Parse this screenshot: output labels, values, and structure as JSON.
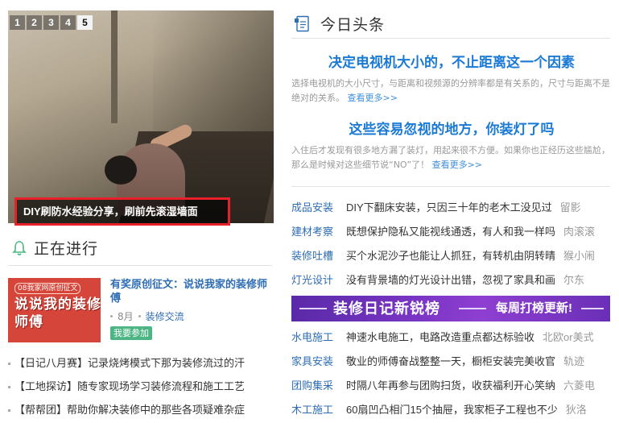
{
  "slider": {
    "numbers": [
      "1",
      "2",
      "3",
      "4",
      "5"
    ],
    "active_index": 4,
    "caption": "DIY刷防水经验分享，刷前先滚湿墙面"
  },
  "in_progress": {
    "title": "正在进行",
    "promo": {
      "image_tag": "08我家网原创征文",
      "image_text": "说说我的装修师傅",
      "title": "有奖原创征文：说说我家的装修师傅",
      "month": "8月",
      "category": "装修交流",
      "join_label": "我要参加"
    },
    "news": [
      "【日记八月赛】记录烧烤模式下那为装修流过的汗",
      "【工地探访】随专家现场学习装修流程和施工工艺",
      "【帮帮团】帮助你解决装修中的那些各项疑难杂症"
    ]
  },
  "headlines": {
    "title": "今日头条",
    "stories": [
      {
        "title": "决定电视机大小的，不止距离这一个因素",
        "summary": "选择电视机的大小尺寸，与距离和视频源的分辨率都是有关系的，尺寸与距离不是绝对的关系。",
        "more": "查看更多>>"
      },
      {
        "title": "这些容易忽视的地方，你装灯了吗",
        "summary": "入住后才发现有很多地方漏了装灯，用起来很不方便。如果你也正经历这些尴尬，那么是时候对这些细节说“NO”了！",
        "more": "查看更多>>"
      }
    ],
    "list_top": [
      {
        "cat": "成品安装",
        "text": "DIY下翻床安装，只因三十年的老木工没见过",
        "author": "留影"
      },
      {
        "cat": "建材考察",
        "text": "既想保护隐私又能视线通透，有人和我一样吗",
        "author": "肉滚滚"
      },
      {
        "cat": "装修吐槽",
        "text": "买个水泥沙子也能让人抓狂，有转机由阴转晴",
        "author": "猴小闹"
      },
      {
        "cat": "灯光设计",
        "text": "没有背景墙的灯光设计出错，忽视了家具和画",
        "author": "尔东"
      }
    ],
    "banner": {
      "main": "装修日记新锐榜",
      "sub": "每周打榜更新!"
    },
    "list_bottom": [
      {
        "cat": "水电施工",
        "text": "神速水电施工，电路改造重点都达标验收",
        "author": "北欧or美式"
      },
      {
        "cat": "家具安装",
        "text": "敬业的师傅奋战整整一天，橱柜安装完美收官",
        "author": "轨迹"
      },
      {
        "cat": "团购集采",
        "text": "时隔八年再参与团购扫货，收获福利开心笑纳",
        "author": "六菱电"
      },
      {
        "cat": "木工施工",
        "text": "60扇凹凸相门15个抽屉，我家柜子工程也不少",
        "author": "狄洛"
      }
    ]
  },
  "colors": {
    "link_blue": "#2e6db3",
    "headline_blue": "#1a7ad6",
    "highlight_red": "#e8202a",
    "join_green": "#4cb584",
    "banner_purple": "#7a35c4"
  },
  "icons": [
    "bell-icon",
    "newspaper-icon"
  ]
}
